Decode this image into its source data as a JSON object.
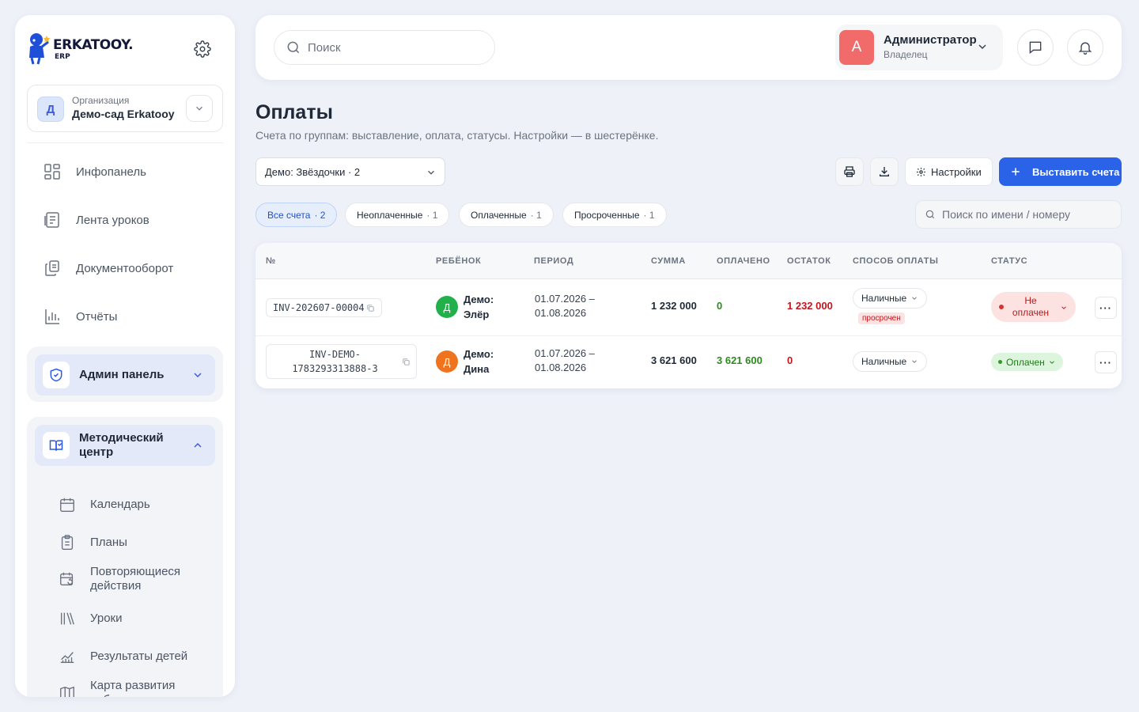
{
  "brand": {
    "name": "ERKATOOY.",
    "sub": "ERP"
  },
  "org": {
    "avatar": "Д",
    "label": "Организация",
    "name": "Демо-сад Erkatooy"
  },
  "nav": [
    {
      "label": "Инфопанель",
      "icon": "dashboard-icon"
    },
    {
      "label": "Лента уроков",
      "icon": "lessons-feed-icon"
    },
    {
      "label": "Документооборот",
      "icon": "documents-icon"
    },
    {
      "label": "Отчёты",
      "icon": "reports-icon"
    }
  ],
  "admin_group": {
    "label": "Админ панель",
    "icon": "shield-check-icon"
  },
  "method_group": {
    "label": "Методический центр",
    "icon": "book-icon",
    "items": [
      {
        "label": "Календарь",
        "icon": "calendar-icon"
      },
      {
        "label": "Планы",
        "icon": "clipboard-icon"
      },
      {
        "label": "Повторяющиеся действия",
        "icon": "calendar-repeat-icon"
      },
      {
        "label": "Уроки",
        "icon": "library-icon"
      },
      {
        "label": "Результаты детей",
        "icon": "chart-line-icon"
      },
      {
        "label": "Карта развития ребенка",
        "icon": "map-icon"
      }
    ]
  },
  "header": {
    "search_placeholder": "Поиск",
    "user": {
      "avatar": "А",
      "name": "Администратор",
      "role": "Владелец"
    }
  },
  "page": {
    "title": "Оплаты",
    "subtitle": "Счета по группам: выставление, оплата, статусы. Настройки — в шестерёнке.",
    "group_select": "Демо: Звёздочки · 2",
    "settings_label": "Настройки",
    "primary_label": "Выставить счета",
    "table_search_placeholder": "Поиск по имени / номеру"
  },
  "filters": [
    {
      "label": "Все счета",
      "count": "· 2",
      "active": true
    },
    {
      "label": "Неоплаченные",
      "count": "· 1",
      "active": false
    },
    {
      "label": "Оплаченные",
      "count": "· 1",
      "active": false
    },
    {
      "label": "Просроченные",
      "count": "· 1",
      "active": false
    }
  ],
  "table": {
    "headers": [
      "№",
      "РЕБЁНОК",
      "ПЕРИОД",
      "СУММА",
      "ОПЛАЧЕНО",
      "ОСТАТОК",
      "СПОСОБ ОПЛАТЫ",
      "СТАТУС"
    ],
    "rows": [
      {
        "invoice": "INV-202607-00004",
        "child_initial": "Д",
        "child_color": "#22b04b",
        "child_name": "Демо: Элёр",
        "period_start": "01.07.2026 –",
        "period_end": "01.08.2026",
        "total": "1 232 000",
        "paid": "0",
        "remaining": "1 232 000",
        "method": "Наличные",
        "badge": "просрочен",
        "status": "Не оплачен"
      },
      {
        "invoice_line1": "INV-DEMO-",
        "invoice_line2": "1783293313888-3",
        "child_initial": "Д",
        "child_color": "#f0741e",
        "child_name": "Демо: Дина",
        "period_start": "01.07.2026 –",
        "period_end": "01.08.2026",
        "total": "3 621 600",
        "paid": "3 621 600",
        "remaining": "0",
        "method": "Наличные",
        "status": "Оплачен"
      }
    ]
  },
  "colors": {
    "primary": "#2b63e8",
    "danger": "#c4161c",
    "success": "#2d8a1f"
  }
}
